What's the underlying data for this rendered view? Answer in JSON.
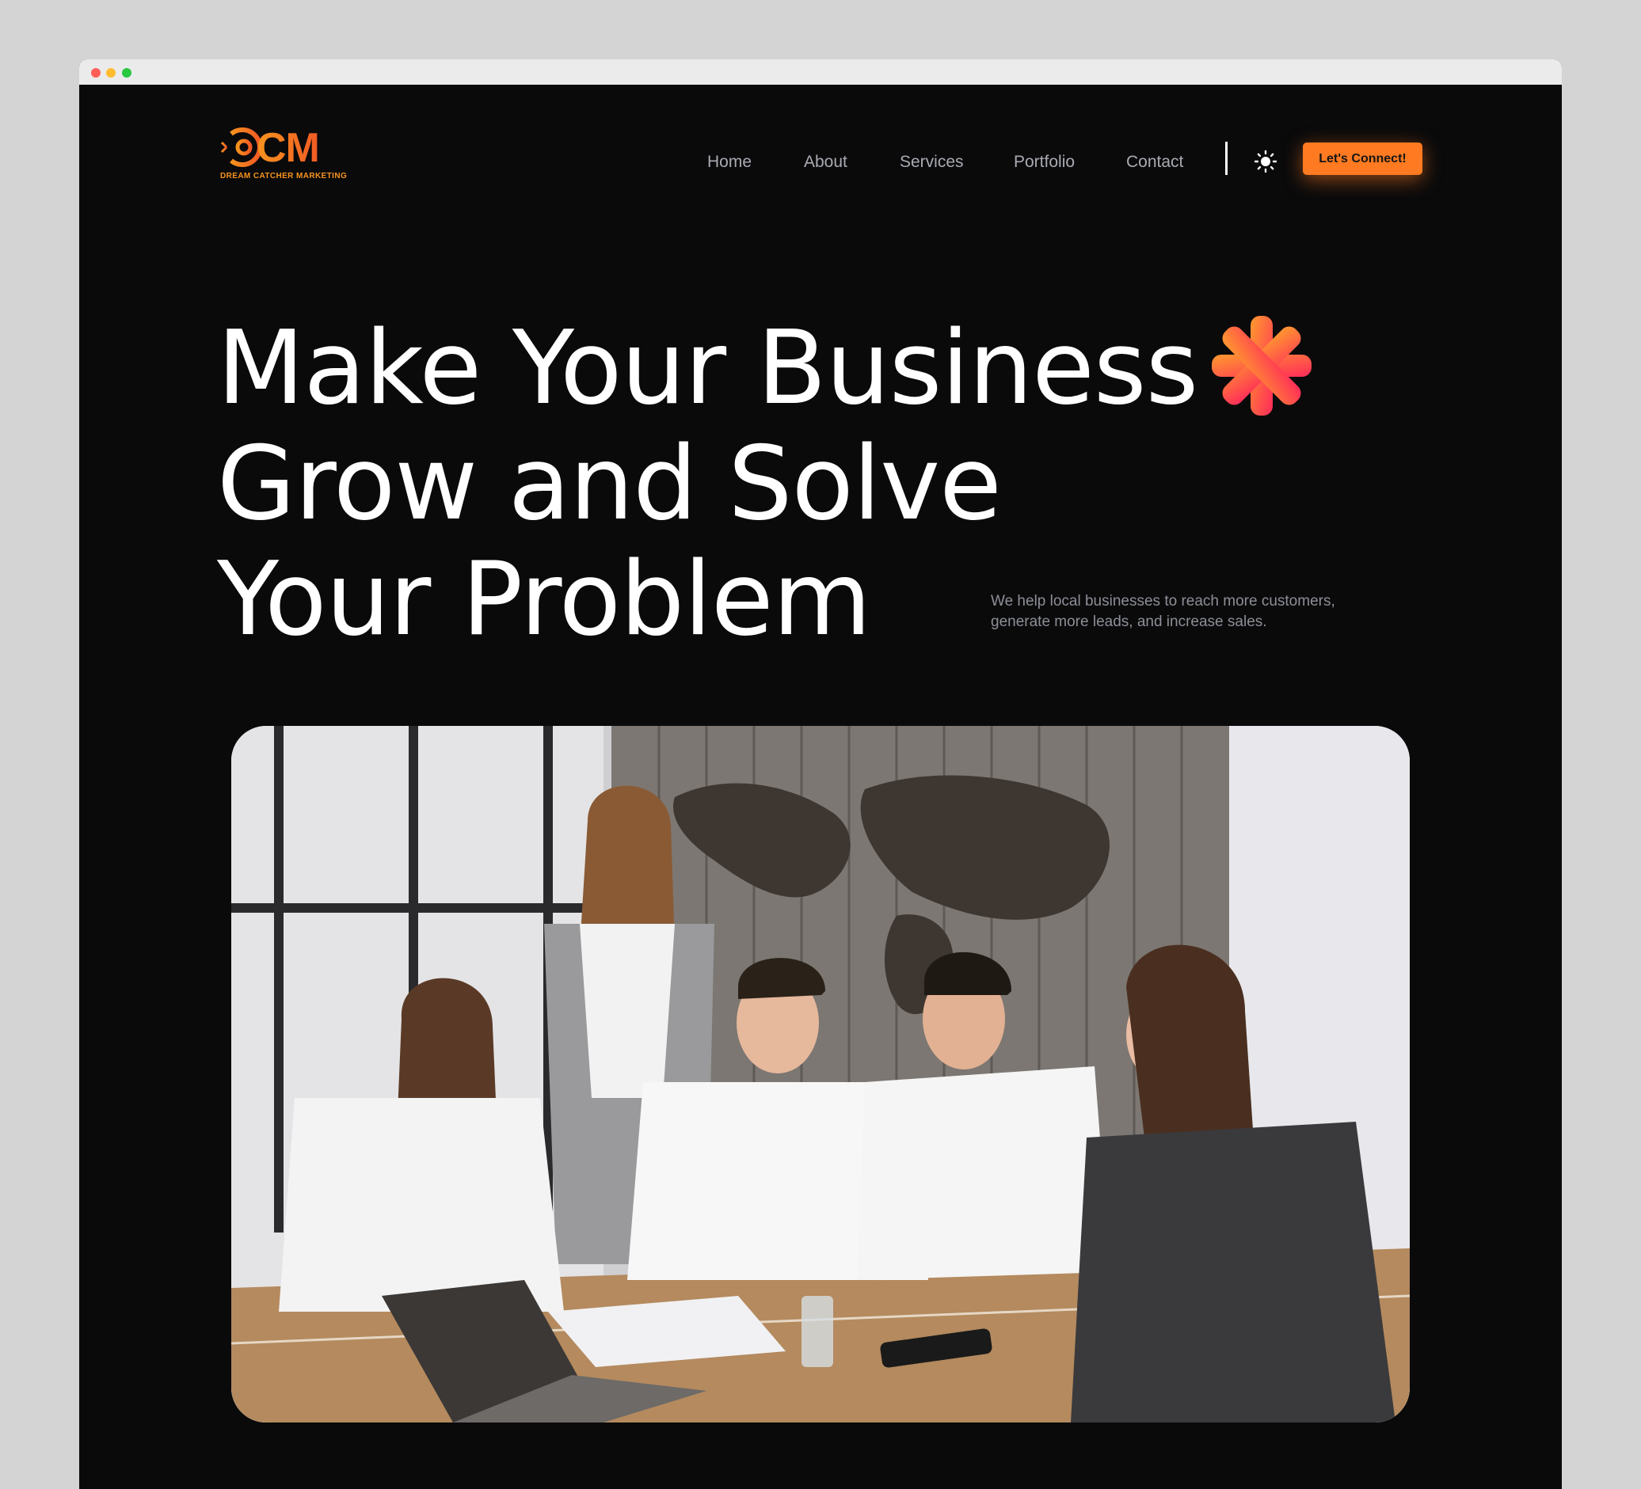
{
  "brand": {
    "logo_text": "CM",
    "logo_sub": "DREAM CATCHER MARKETING",
    "accent": "#ff7a21",
    "logo_gradient": [
      "#f7931e",
      "#f15a24"
    ]
  },
  "nav": {
    "items": [
      {
        "label": "Home"
      },
      {
        "label": "About"
      },
      {
        "label": "Services"
      },
      {
        "label": "Portfolio"
      },
      {
        "label": "Contact"
      }
    ],
    "theme_icon": "sun-icon",
    "cta_label": "Let's Connect!"
  },
  "hero": {
    "title_lines": [
      "Make Your Business",
      "Grow and Solve",
      "Your Problem"
    ],
    "subtitle": "We help local businesses to reach more customers, generate more leads, and increase sales.",
    "decoration_icon": "asterisk-burst-icon",
    "image_alt": "team-meeting-photo"
  }
}
